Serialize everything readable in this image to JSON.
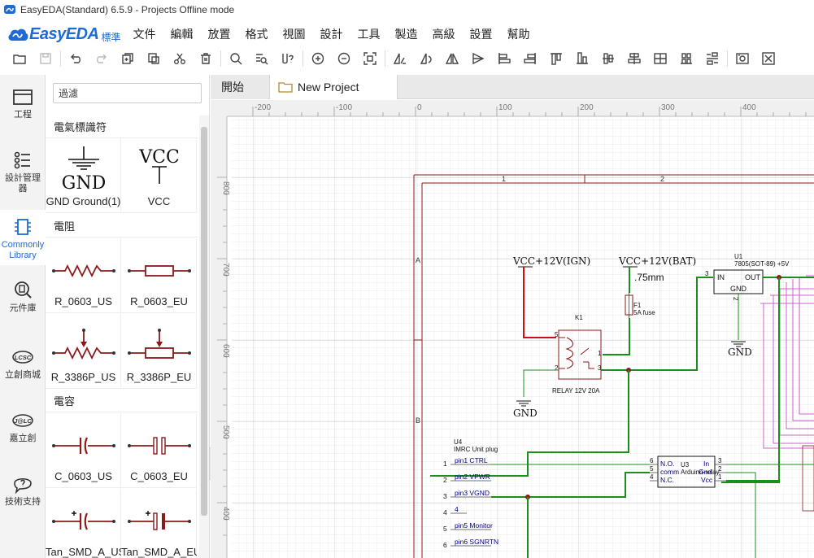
{
  "window": {
    "title": "EasyEDA(Standard) 6.5.9 - Projects Offline mode"
  },
  "brand": {
    "logo_text": "EasyEDA",
    "edition": "標準"
  },
  "menu": [
    "文件",
    "編輯",
    "放置",
    "格式",
    "視圖",
    "設計",
    "工具",
    "製造",
    "高級",
    "設置",
    "幫助"
  ],
  "toolbar_icons": [
    "new-folder-icon",
    "save-icon",
    "undo-icon",
    "redo-icon",
    "copy-icon",
    "paste-icon",
    "cut-icon",
    "delete-icon",
    "search-icon",
    "find-icon",
    "help-icon",
    "zoom-in-icon",
    "zoom-out-icon",
    "fit-icon",
    "rotate-icon",
    "flip-icon",
    "mirror-icon",
    "align-icon",
    "align-left-icon",
    "align-right-icon",
    "align-top-icon",
    "align-bottom-icon",
    "align-hcenter-icon",
    "align-vcenter-icon",
    "grid-icon",
    "distribute-icon",
    "distribute-v-icon",
    "image-icon",
    "shrink-icon"
  ],
  "left_nav": [
    {
      "label": "工程",
      "icon": "folder-icon"
    },
    {
      "label": "設計管理器",
      "icon": "list-icon"
    },
    {
      "label": "Commonly Library",
      "icon": "chip-icon",
      "active": true
    },
    {
      "label": "元件庫",
      "icon": "search-component-icon"
    },
    {
      "label": "立創商城",
      "icon": "lcsc-icon",
      "badge": "LCSC"
    },
    {
      "label": "嘉立創",
      "icon": "jlc-icon",
      "badge": "J@LC"
    },
    {
      "label": "技術支持",
      "icon": "support-icon"
    }
  ],
  "library": {
    "filter_placeholder": "過濾",
    "categories": [
      {
        "name": "電氣標識符",
        "items": [
          "GND Ground(1)",
          "VCC"
        ]
      },
      {
        "name": "電阻",
        "items": [
          "R_0603_US",
          "R_0603_EU",
          "R_3386P_US",
          "R_3386P_EU"
        ]
      },
      {
        "name": "電容",
        "items": [
          "C_0603_US",
          "C_0603_EU",
          "Tan_SMD_A_US",
          "Tan_SMD_A_EU"
        ]
      }
    ],
    "symbol_text": {
      "gnd": "GND",
      "vcc": "VCC"
    }
  },
  "tabs": {
    "home": "開始",
    "project": "New Project"
  },
  "rulers": {
    "horizontal": [
      "-200",
      "-100",
      "0",
      "100",
      "200",
      "300",
      "400"
    ],
    "vertical": [
      "800",
      "700",
      "600",
      "500",
      "400"
    ]
  },
  "schematic": {
    "frame_columns": [
      "1",
      "2"
    ],
    "frame_rows": [
      "A",
      "B"
    ],
    "net_vcc_ign": "VCC+12V(IGN)",
    "net_vcc_bat": "VCC+12V(BAT)",
    "trace_width": ".75mm",
    "fuse": {
      "ref": "F1",
      "value": "5A fuse"
    },
    "relay": {
      "ref": "K1",
      "name": "RELAY 12V 20A",
      "pins": [
        "5",
        "1",
        "2",
        "3"
      ]
    },
    "gnd_label": "GND",
    "regulator": {
      "ref": "U1",
      "name": "7805(SOT-89) +5V",
      "in": "IN",
      "out": "OUT",
      "gnd": "GND",
      "pin_in": "3",
      "pin_gnd": "2"
    },
    "imrc": {
      "ref": "U4",
      "name": "IMRC Unit plug",
      "pins": [
        {
          "num": "1",
          "label": "pin1 CTRL"
        },
        {
          "num": "2",
          "label": "pin2 VPWR"
        },
        {
          "num": "3",
          "label": "pin3 VGND"
        },
        {
          "num": "4",
          "label": "4"
        },
        {
          "num": "5",
          "label": "pin5 Monitor"
        },
        {
          "num": "6",
          "label": "pin6 SGNRTN"
        }
      ]
    },
    "arduino_relay": {
      "ref": "U3",
      "name": "Arduino-relay",
      "left_pins": [
        {
          "num": "6",
          "label": "N.O."
        },
        {
          "num": "5",
          "label": "comm"
        },
        {
          "num": "4",
          "label": "N.C."
        }
      ],
      "right_pins": [
        {
          "num": "3",
          "label": "In"
        },
        {
          "num": "2",
          "label": "Gnd"
        },
        {
          "num": "1",
          "label": "Vcc"
        }
      ]
    }
  },
  "colors": {
    "brand": "#1e6bd6",
    "wire": "#1a8f1a",
    "power_wire": "#d01010",
    "part": "#8b1a1a",
    "frame": "#8b1a1a",
    "net_label": "#000080",
    "bus": "#d060d0"
  }
}
